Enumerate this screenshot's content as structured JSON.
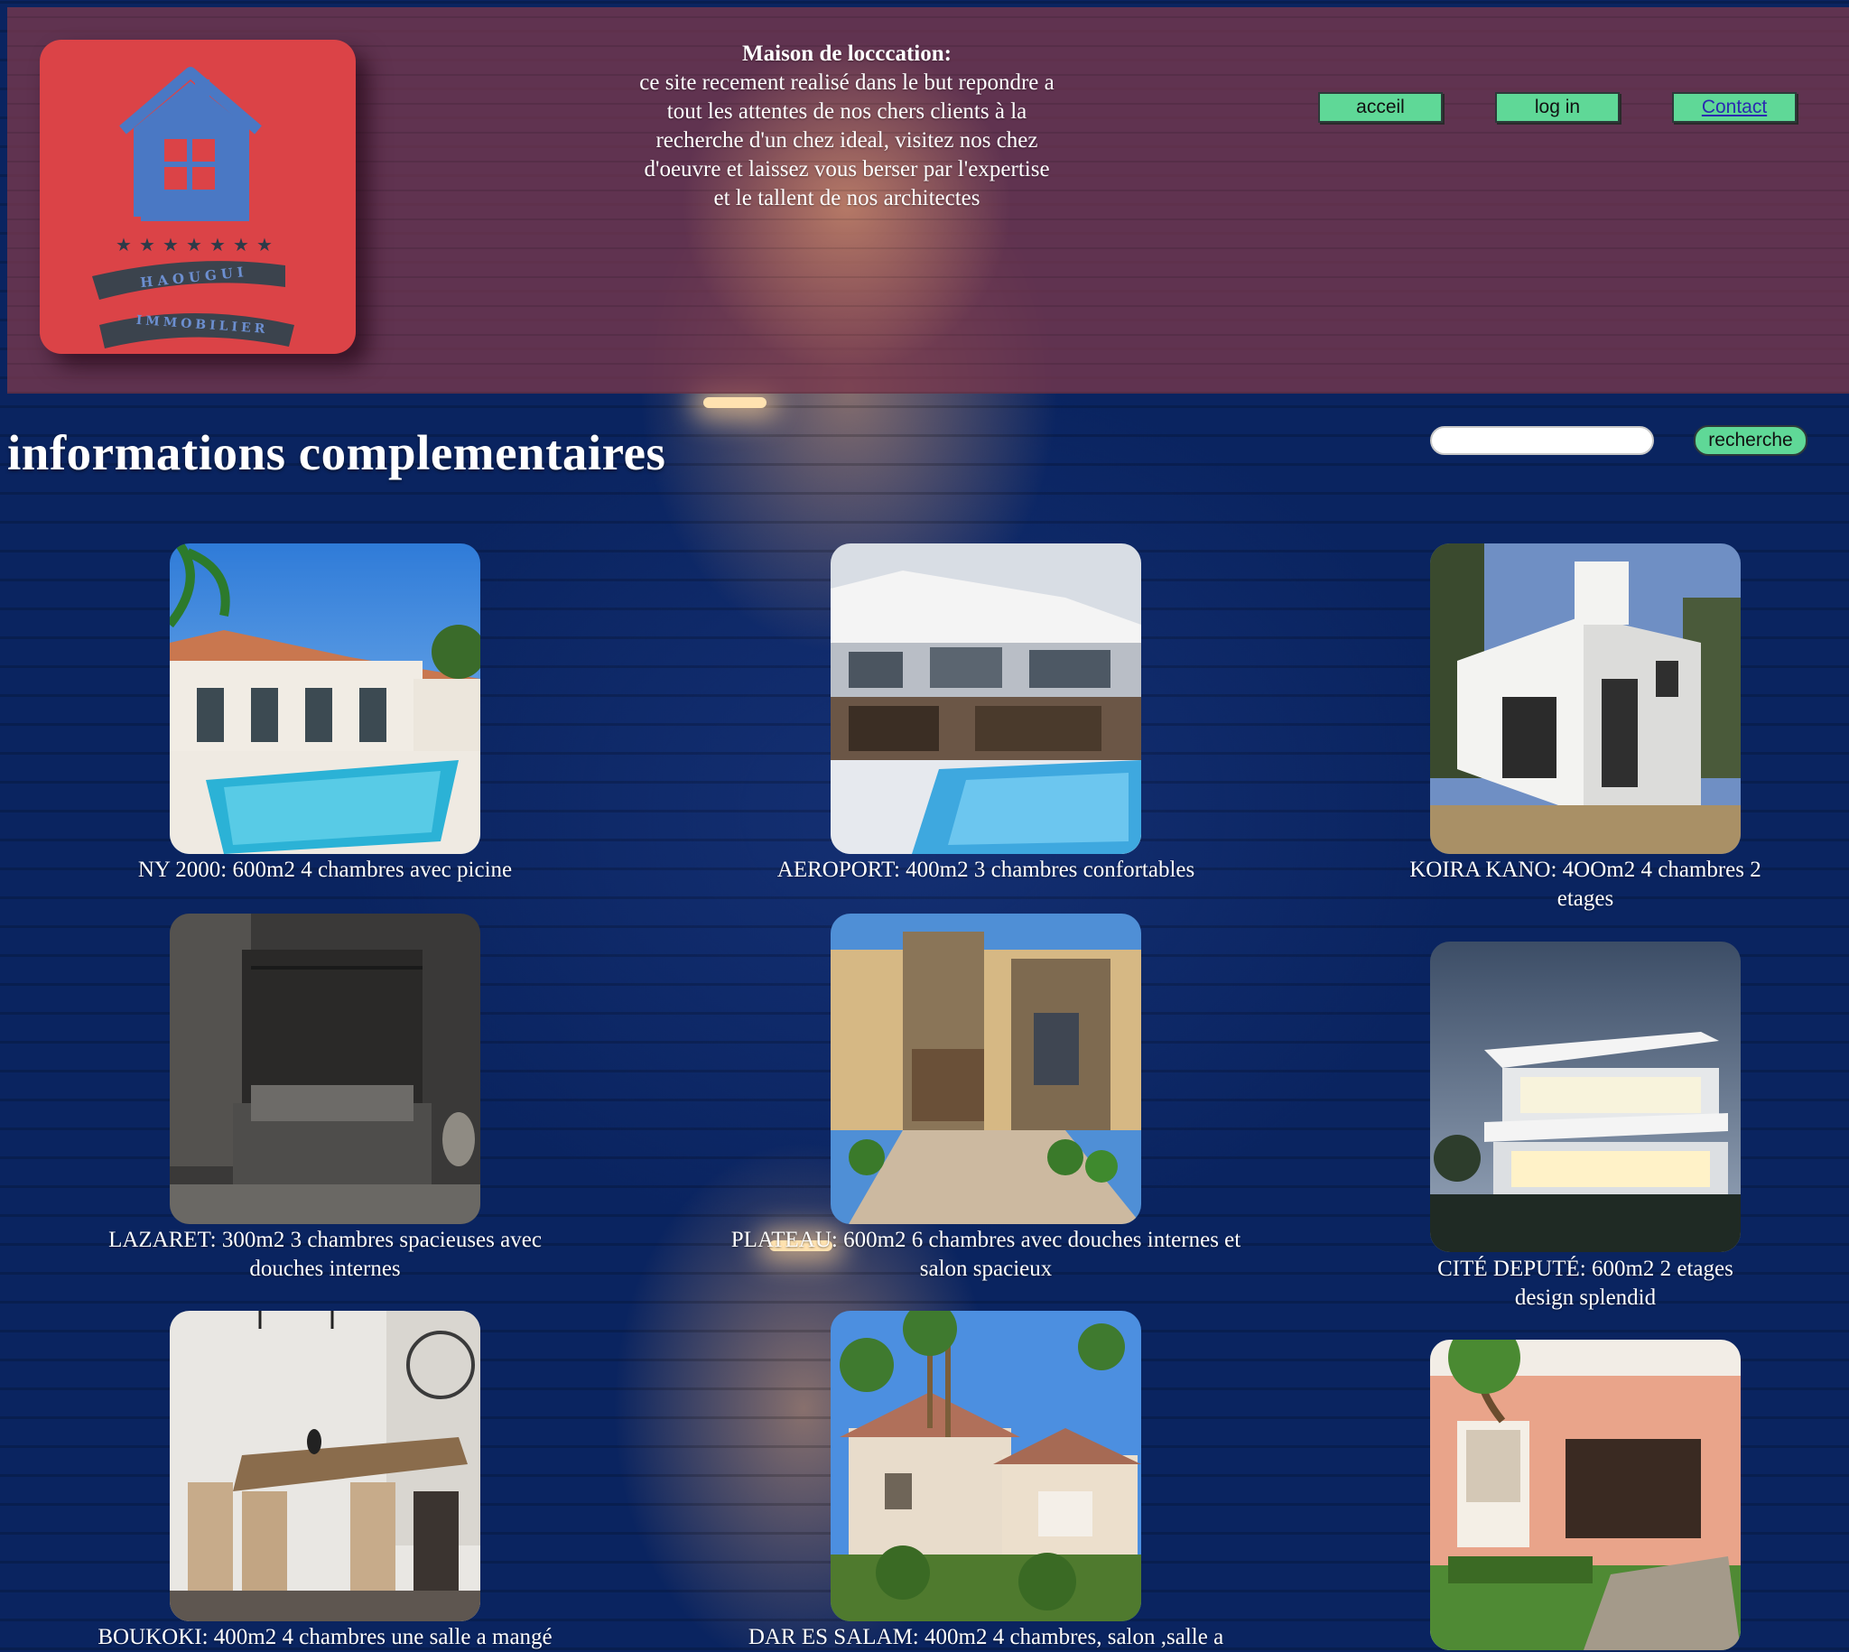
{
  "header": {
    "logo": {
      "brand_top": "HAOUGUI",
      "brand_bottom": "IMMOBILIER"
    },
    "intro_title": "Maison de locccation:",
    "intro_lines": [
      "ce site recement realisé dans le but repondre a",
      "tout les attentes de nos chers clients à la",
      "recherche d'un chez ideal, visitez nos chez",
      "d'oeuvre et laissez vous berser par l'expertise",
      "et le tallent de nos architectes"
    ],
    "nav": {
      "home": "acceil",
      "login": "log in",
      "contact": "Contact"
    }
  },
  "main": {
    "title": "informations complementaires",
    "search": {
      "placeholder": "",
      "button": "recherche"
    },
    "properties": [
      {
        "lines": [
          "NY 2000: 600m2 4 chambres avec picine"
        ]
      },
      {
        "lines": [
          "AEROPORT: 400m2 3 chambres confortables"
        ]
      },
      {
        "lines": [
          "KOIRA KANO: 4OOm2 4 chambres 2",
          "etages"
        ]
      },
      {
        "lines": [
          "LAZARET: 300m2 3 chambres spacieuses avec",
          "douches internes"
        ]
      },
      {
        "lines": [
          "PLATEAU: 600m2 6 chambres avec douches internes et",
          "salon spacieux"
        ]
      },
      {
        "lines": [
          "CITÉ DEPUTÉ: 600m2 2 etages",
          "design splendid"
        ]
      },
      {
        "lines": [
          "BOUKOKI: 400m2 4 chambres une salle a mangé"
        ]
      },
      {
        "lines": [
          "DAR ES SALAM: 400m2 4 chambres, salon ,salle a"
        ]
      },
      {
        "lines": [
          ""
        ]
      }
    ]
  },
  "colors": {
    "header_bg": "#7e3a4e",
    "page_bg": "#0a2460",
    "logo_bg": "#db4347",
    "button_green": "#5fd897",
    "house_blue": "#4a78c4"
  }
}
